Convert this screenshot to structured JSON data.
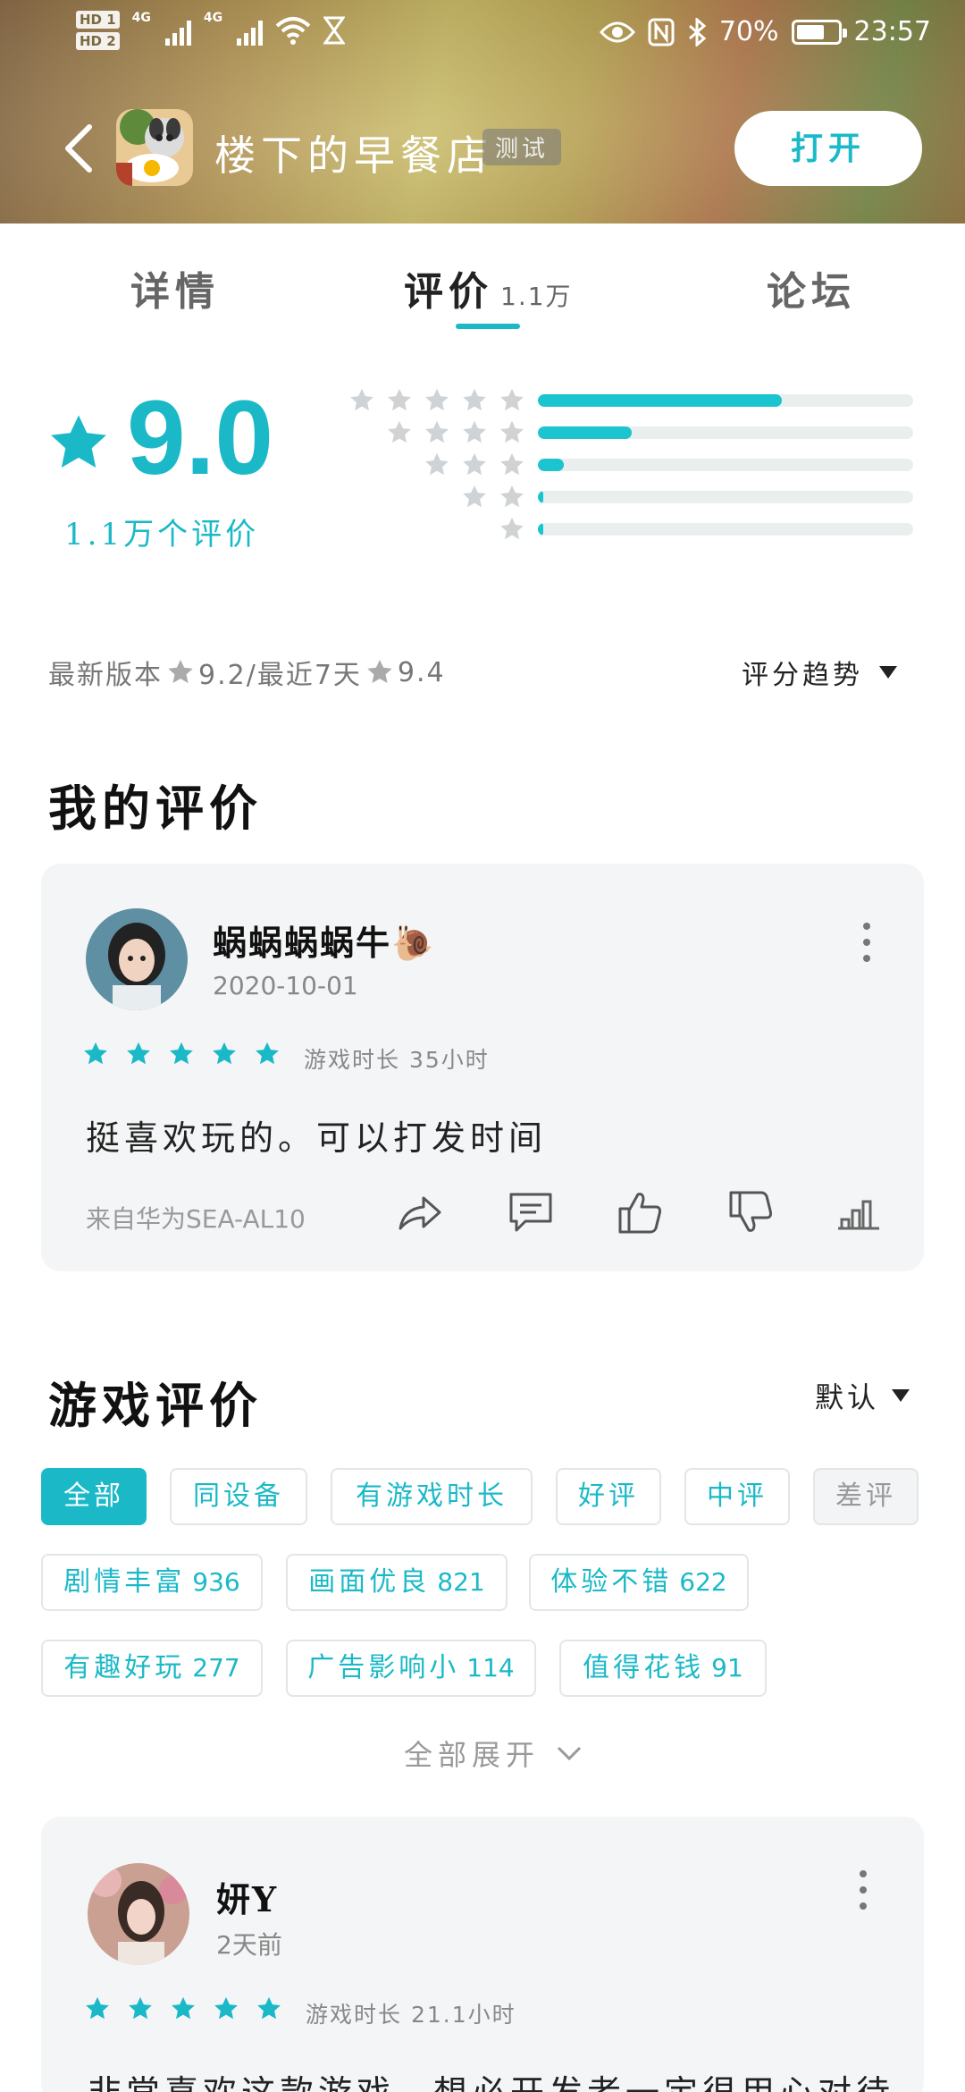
{
  "status_bar": {
    "sim1": "HD 1",
    "sim2": "HD 2",
    "net1": "4G",
    "net2": "4G",
    "battery_pct": "70%",
    "time": "23:57"
  },
  "app": {
    "title": "楼下的早餐店",
    "badge": "测试",
    "open_label": "打开"
  },
  "tabs": [
    {
      "label": "详情"
    },
    {
      "label": "评价",
      "count": "1.1万"
    },
    {
      "label": "论坛"
    }
  ],
  "rating": {
    "score": "9.0",
    "count_label": "1.1万个评价",
    "distribution": [
      {
        "stars": 5,
        "fraction": 0.65
      },
      {
        "stars": 4,
        "fraction": 0.25
      },
      {
        "stars": 3,
        "fraction": 0.07
      },
      {
        "stars": 2,
        "fraction": 0.015
      },
      {
        "stars": 1,
        "fraction": 0.015
      }
    ],
    "latest_version_label": "最新版本",
    "latest_version_score": "9.2/最近7天",
    "recent_score": "9.4",
    "trend_label": "评分趋势"
  },
  "my_review": {
    "section_title": "我的评价",
    "user": "蜗蜗蜗蜗牛🐌",
    "date": "2020-10-01",
    "stars": 5,
    "play_time": "游戏时长 35小时",
    "text": "挺喜欢玩的。可以打发时间",
    "device": "来自华为SEA-AL10"
  },
  "game_reviews": {
    "section_title": "游戏评价",
    "sort_label": "默认",
    "filters": [
      {
        "label": "全部",
        "active": true
      },
      {
        "label": "同设备"
      },
      {
        "label": "有游戏时长"
      },
      {
        "label": "好评"
      },
      {
        "label": "中评"
      },
      {
        "label": "差评"
      }
    ],
    "tags": [
      {
        "label": "剧情丰富",
        "count": "936"
      },
      {
        "label": "画面优良",
        "count": "821"
      },
      {
        "label": "体验不错",
        "count": "622"
      },
      {
        "label": "有趣好玩",
        "count": "277"
      },
      {
        "label": "广告影响小",
        "count": "114"
      },
      {
        "label": "值得花钱",
        "count": "91"
      }
    ],
    "expand_label": "全部展开",
    "first_review": {
      "user": "妍Y",
      "date": "2天前",
      "stars": 5,
      "play_time": "游戏时长 21.1小时",
      "text": "非常喜欢这款游戏，想必开发者一定很用心对待"
    }
  },
  "colors": {
    "accent": "#1bb9c8",
    "card_bg": "#f4f5f6"
  }
}
